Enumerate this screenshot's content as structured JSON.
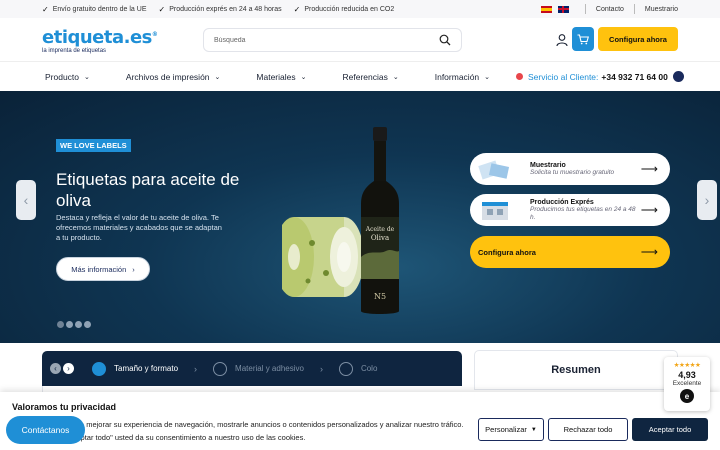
{
  "topbar": {
    "usps": [
      "Envío gratuito dentro de la UE",
      "Producción exprés en 24 a 48 horas",
      "Producción reducida en CO2"
    ],
    "contact": "Contacto",
    "samples": "Muestrario"
  },
  "header": {
    "logo_text": "etiqueta.es",
    "logo_tagline": "la imprenta de etiquetas",
    "search_placeholder": "Búsqueda",
    "cta": "Configura ahora"
  },
  "nav": {
    "items": [
      "Producto",
      "Archivos de impresión",
      "Materiales",
      "Referencias",
      "Información"
    ],
    "service_label": "Servicio al Cliente:",
    "service_phone": "+34 932 71 64 00"
  },
  "hero": {
    "tag": "WE LOVE LABELS",
    "title": "Etiquetas para aceite de oliva",
    "description": "Destaca y refleja el valor de tu aceite de oliva. Te ofrecemos materiales y acabados que se adaptan a tu producto.",
    "more_button": "Más información",
    "slide_count": 4,
    "active_slide": 1,
    "bottle_label_line1": "Aceite de",
    "bottle_label_line2": "Oliva",
    "bottle_number": "N5"
  },
  "quick_links": [
    {
      "title": "Muestrario",
      "subtitle": "Solicita tu muestrario gratuito"
    },
    {
      "title": "Producción Exprés",
      "subtitle": "Producimos tus etiquetas en 24 a 48 h."
    },
    {
      "title": "Configura ahora",
      "subtitle": ""
    }
  ],
  "configurator": {
    "steps": [
      "Tamaño y formato",
      "Material y adhesivo",
      "Colo"
    ],
    "active_step": 1
  },
  "summary": {
    "title": "Resumen"
  },
  "review": {
    "score": "4,93",
    "label": "Excelente"
  },
  "cookie": {
    "title": "Valoramos tu privacidad",
    "text": "Usamos cookies para mejorar su experiencia de navegación, mostrarle anuncios o contenidos personalizados y analizar nuestro tráfico. Al hacer clic en \"Aceptar todo\" usted da su consentimiento a nuestro uso de las cookies.",
    "customize": "Personalizar",
    "reject": "Rechazar todo",
    "accept": "Aceptar todo"
  },
  "contact_button": "Contáctanos",
  "colors": {
    "brand_blue": "#1f8fd6",
    "navy": "#0f2540",
    "yellow": "#ffc20e"
  }
}
